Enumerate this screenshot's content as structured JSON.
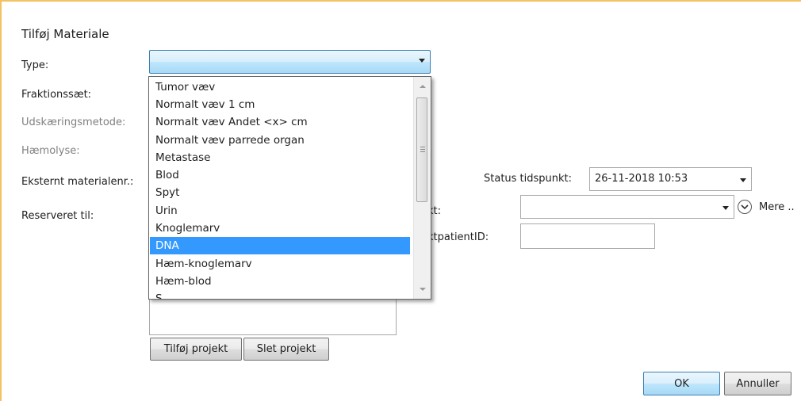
{
  "dialog": {
    "title": "Tilføj Materiale",
    "labels": {
      "type": "Type:",
      "fraction_set": "Fraktionssæt:",
      "cutting_method": "Udskæringsmetode:",
      "hemolysis": "Hæmolyse:",
      "external_material_no": "Eksternt materialenr.:",
      "reserved_for": "Reserveret til:",
      "status_timestamp": "Status tidspunkt:",
      "project": "ekt:",
      "project_patient_id": "ektpatientID:"
    },
    "type_value": "",
    "status_timestamp_value": "26-11-2018 10:53",
    "project_value": "",
    "project_patient_id_value": "",
    "more_label": "Mere ..",
    "buttons": {
      "add_project": "Tilføj projekt",
      "delete_project": "Slet projekt",
      "ok": "OK",
      "cancel": "Annuller"
    }
  },
  "type_dropdown": {
    "options": [
      "Tumor væv",
      "Normalt væv 1 cm",
      "Normalt væv Andet <x> cm",
      "Normalt væv parrede organ",
      "Metastase",
      "Blod",
      "Spyt",
      "Urin",
      "Knoglemarv",
      "DNA",
      "Hæm-knoglemarv",
      "Hæm-blod",
      "S"
    ],
    "highlighted": "DNA"
  },
  "colors": {
    "frame_accent": "#f3c262",
    "selection": "#3399ff",
    "focus_border": "#3c7fb1"
  }
}
